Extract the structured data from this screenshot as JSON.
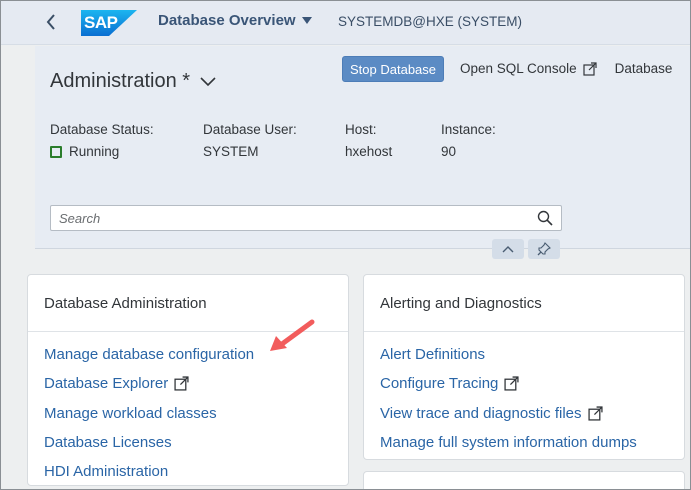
{
  "shell": {
    "logo_text": "SAP",
    "app_title": "Database Overview",
    "system": "SYSTEMDB@HXE (SYSTEM)"
  },
  "header": {
    "title": "Administration *",
    "actions": {
      "stop_database": "Stop Database",
      "open_sql_console": "Open SQL Console",
      "database_more": "Database"
    },
    "attributes": [
      {
        "label": "Database Status:",
        "value": "Running"
      },
      {
        "label": "Database User:",
        "value": "SYSTEM"
      },
      {
        "label": "Host:",
        "value": "hxehost"
      },
      {
        "label": "Instance:",
        "value": "90"
      }
    ],
    "search": {
      "placeholder": "Search"
    }
  },
  "cards": {
    "database_administration": {
      "title": "Database Administration",
      "links": [
        "Manage database configuration",
        "Database Explorer",
        "Manage workload classes",
        "Database Licenses",
        "HDI Administration"
      ]
    },
    "alerting": {
      "title": "Alerting and Diagnostics",
      "links": [
        "Alert Definitions",
        "Configure Tracing",
        "View trace and diagnostic files",
        "Manage full system information dumps"
      ]
    }
  },
  "colors": {
    "brand_blue": "#0a6ed1",
    "link": "#2a65a6",
    "status_ok": "#2b7d2b",
    "arrow": "#f25c5c"
  },
  "icons": {
    "back": "chevron-left-icon",
    "title_dropdown": "triangle-down-icon",
    "header_dropdown": "chevron-down-icon",
    "external": "external-link-icon",
    "search": "search-icon",
    "collapse": "chevron-up-icon",
    "pin": "pin-icon"
  }
}
